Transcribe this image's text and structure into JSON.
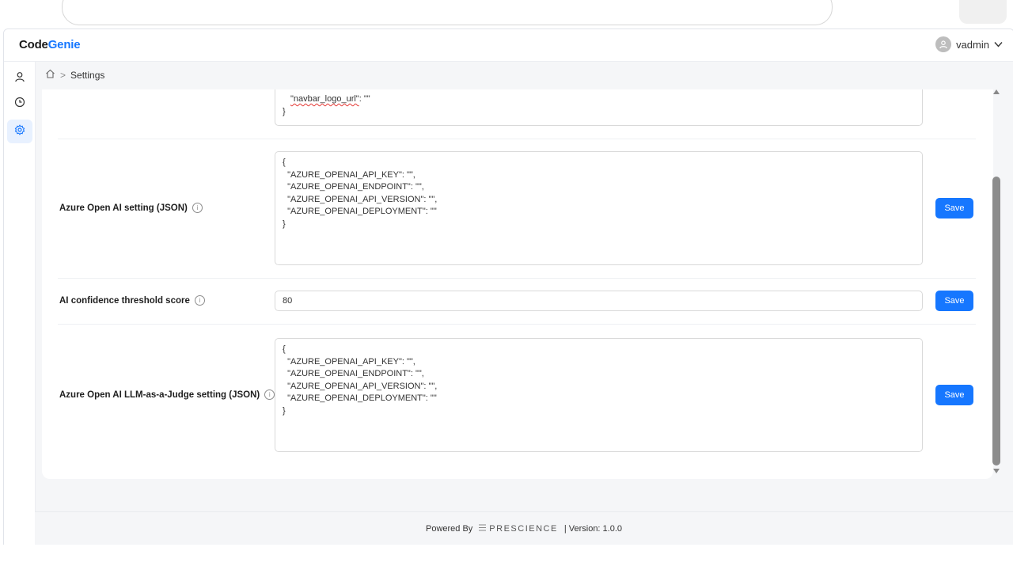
{
  "app": {
    "logo_code": "Code",
    "logo_genie": "Genie",
    "user_name": "vadmin"
  },
  "breadcrumb": {
    "home_icon": "home-icon",
    "separator": ">",
    "current": "Settings"
  },
  "rail": [
    {
      "icon": "user-icon",
      "active": false
    },
    {
      "icon": "history-icon",
      "active": false
    },
    {
      "icon": "settings-icon",
      "active": true
    }
  ],
  "settings": {
    "top_fragment": {
      "line1_key": "\"navbar_logo_url\"",
      "line1_rest": ": \"\"",
      "line2": "}"
    },
    "azure_openai": {
      "label": "Azure Open AI setting (JSON)",
      "value": "{\n  \"AZURE_OPENAI_API_KEY\": \"\",\n  \"AZURE_OPENAI_ENDPOINT\": \"\",\n  \"AZURE_OPENAI_API_VERSION\": \"\",\n  \"AZURE_OPENAI_DEPLOYMENT\": \"\"\n}",
      "save_label": "Save"
    },
    "confidence": {
      "label": "AI confidence threshold score",
      "value": "80",
      "save_label": "Save"
    },
    "judge": {
      "label": "Azure Open AI LLM-as-a-Judge setting (JSON)",
      "value": "{\n  \"AZURE_OPENAI_API_KEY\": \"\",\n  \"AZURE_OPENAI_ENDPOINT\": \"\",\n  \"AZURE_OPENAI_API_VERSION\": \"\",\n  \"AZURE_OPENAI_DEPLOYMENT\": \"\"\n}",
      "save_label": "Save"
    }
  },
  "footer": {
    "powered_by": "Powered By",
    "brand": "PRESCIENCE",
    "version": "| Version: 1.0.0"
  },
  "colors": {
    "accent": "#1677ff",
    "page_bg": "#f5f6f8"
  }
}
